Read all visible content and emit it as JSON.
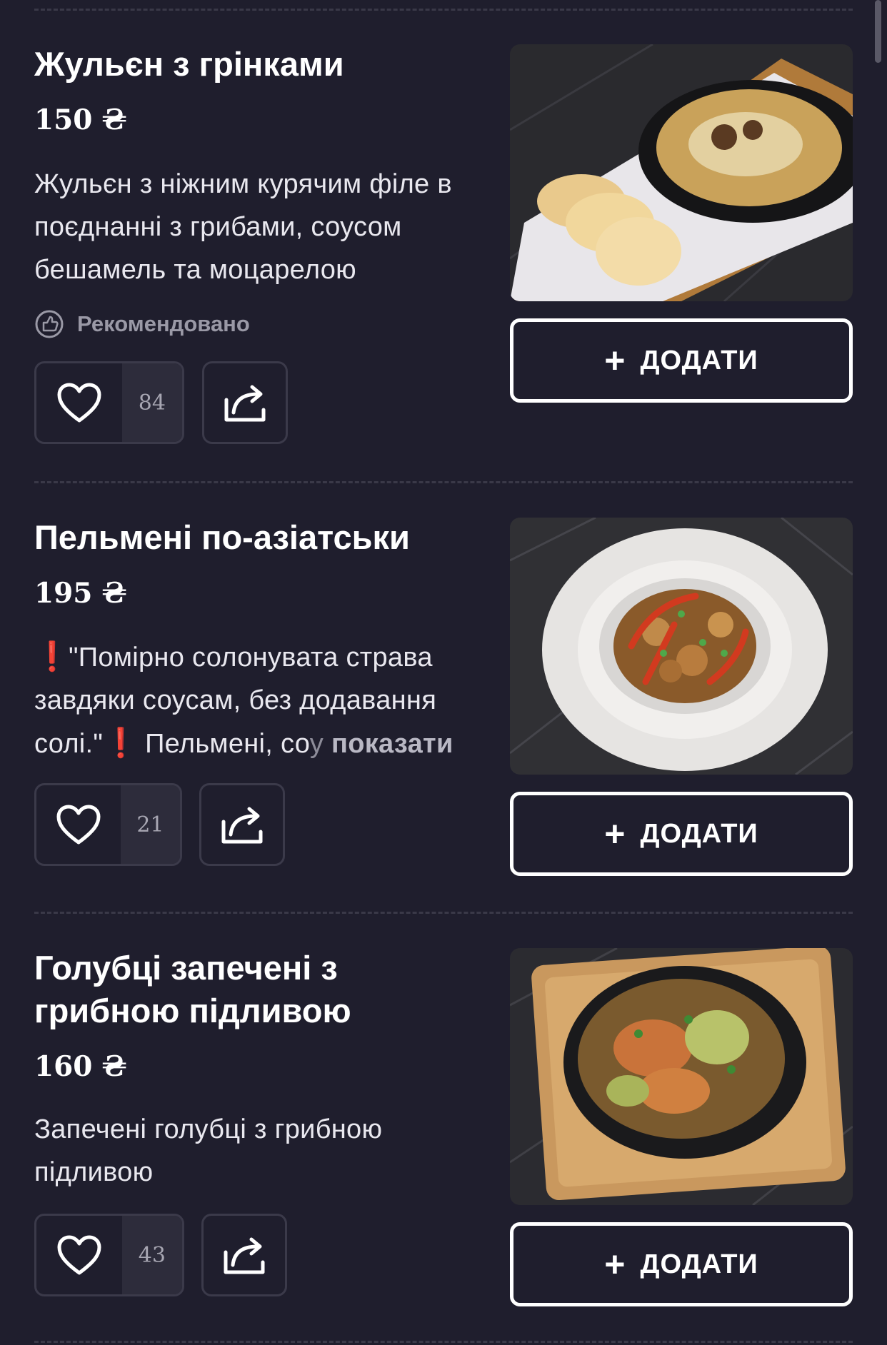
{
  "colors": {
    "background": "#1f1e2d",
    "button_border": "#ffffff",
    "warning": "#e5222c",
    "muted": "#9a99a6"
  },
  "add_label": "ДОДАТИ",
  "add_plus": "+",
  "items": [
    {
      "title": "Жульєн з грінками",
      "price": "150 ₴",
      "description": "Жульєн з ніжним курячим філе в поєднанні з грибами, соусом бешамель та моцарелою",
      "badge": "Рекомендовано",
      "likes": "84",
      "photo": "julienne-photo"
    },
    {
      "title": "Пельмені по-азіатськи",
      "price": "195 ₴",
      "warning_icon": "❗",
      "description_main": "\"Помірно солонувата страва завдяки соусам, без додавання солі.\"",
      "description_tail": "Пельмені, со",
      "description_fade": "у",
      "show_more": "показати",
      "likes": "21",
      "photo": "dumplings-photo"
    },
    {
      "title": "Голубці запечені з грибною підливою",
      "price": "160 ₴",
      "description": "Запечені голубці з грибною підливою",
      "likes": "43",
      "photo": "cabbage-rolls-photo"
    }
  ]
}
